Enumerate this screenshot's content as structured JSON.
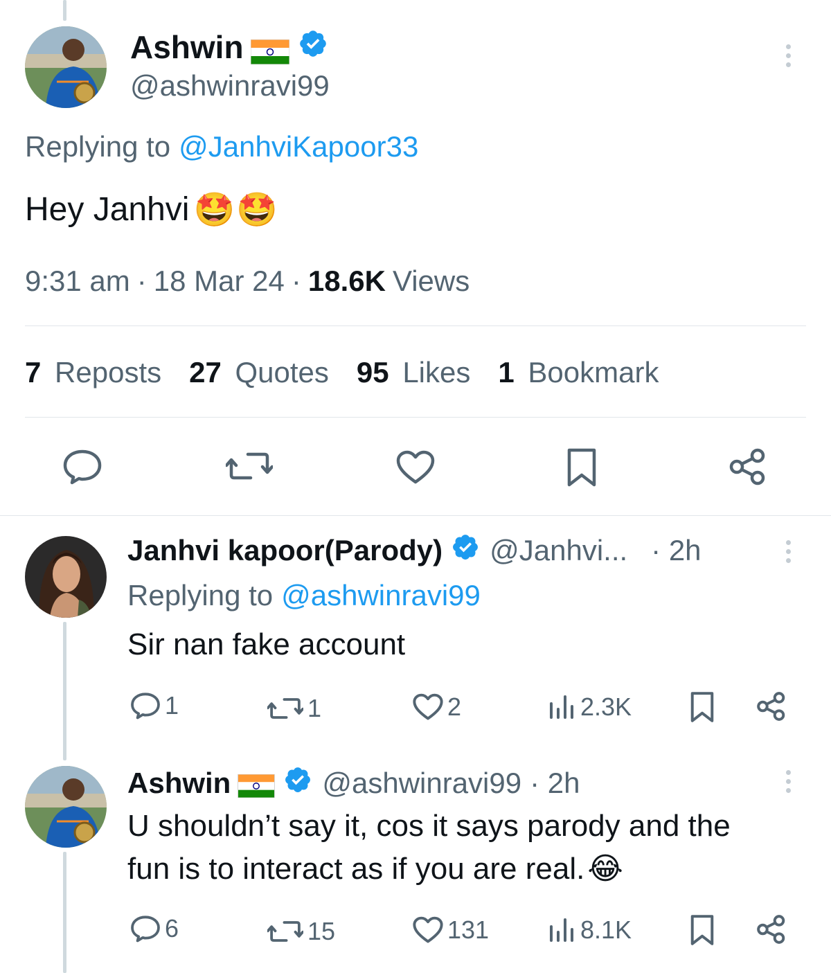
{
  "main_tweet": {
    "author_name": "Ashwin",
    "author_handle": "@ashwinravi99",
    "replying_prefix": "Replying to",
    "replying_to": "@JanhviKapoor33",
    "text": "Hey Janhvi",
    "emojis": "🤩🤩",
    "time": "9:31 am",
    "date": "18 Mar 24",
    "views_count": "18.6K",
    "views_label": "Views",
    "separator": "·",
    "stats": [
      {
        "count": "7",
        "label": "Reposts"
      },
      {
        "count": "27",
        "label": "Quotes"
      },
      {
        "count": "95",
        "label": "Likes"
      },
      {
        "count": "1",
        "label": "Bookmark"
      }
    ]
  },
  "reply_1": {
    "author_name": "Janhvi kapoor(Parody)",
    "author_handle": "@Janhvi...",
    "time": "· 2h",
    "replying_prefix": "Replying to",
    "replying_to": "@ashwinravi99",
    "text": "Sir nan fake account",
    "replies": "1",
    "reposts": "1",
    "likes": "2",
    "views": "2.3K"
  },
  "reply_2": {
    "author_name": "Ashwin",
    "author_handle": "@ashwinravi99",
    "time": "· 2h",
    "text_line1": "U shouldn’t say it, cos it says parody and the",
    "text_line2": "fun is to interact as if you are real.",
    "emoji": "😂",
    "replies": "6",
    "reposts": "15",
    "likes": "131",
    "views": "8.1K"
  },
  "colors": {
    "link": "#1d9bf0",
    "muted": "#536471",
    "verified": "#1d9bf0",
    "divider": "#e1e6ea"
  },
  "icons": {
    "reply": "speech-bubble-icon",
    "repost": "repost-arrows-icon",
    "like": "heart-icon",
    "bookmark": "bookmark-icon",
    "share": "share-icon",
    "views": "bar-chart-icon",
    "more": "vertical-ellipsis-icon",
    "verified": "verified-badge-icon",
    "flag": "india-flag-icon"
  }
}
